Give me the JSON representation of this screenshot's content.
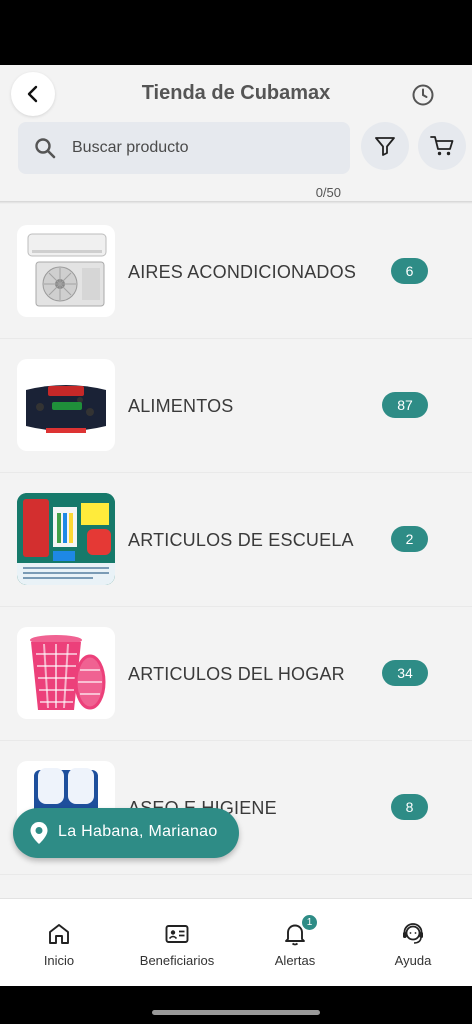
{
  "header": {
    "title": "Tienda de Cubamax",
    "search_placeholder": "Buscar producto",
    "counter": "0/50"
  },
  "categories": [
    {
      "label": "AIRES ACONDICIONADOS",
      "count": "6",
      "image": "air-conditioner-image"
    },
    {
      "label": "ALIMENTOS",
      "count": "87",
      "image": "black-beans-package-image"
    },
    {
      "label": "ARTICULOS DE ESCUELA",
      "count": "2",
      "image": "school-supplies-image"
    },
    {
      "label": "ARTICULOS DEL HOGAR",
      "count": "34",
      "image": "pink-laundry-basket-image"
    },
    {
      "label": "ASEO E HIGIENE",
      "count": "8",
      "image": "paper-towel-rolls-image"
    }
  ],
  "location": {
    "label": "La Habana, Marianao"
  },
  "tabs": [
    {
      "label": "Inicio",
      "icon": "home-icon"
    },
    {
      "label": "Beneficiarios",
      "icon": "id-card-icon"
    },
    {
      "label": "Alertas",
      "icon": "bell-icon",
      "badge": "1"
    },
    {
      "label": "Ayuda",
      "icon": "headset-icon"
    }
  ],
  "colors": {
    "accent": "#2e8c86",
    "background": "#f3f3f3",
    "search_bg": "#e6e9ee"
  }
}
